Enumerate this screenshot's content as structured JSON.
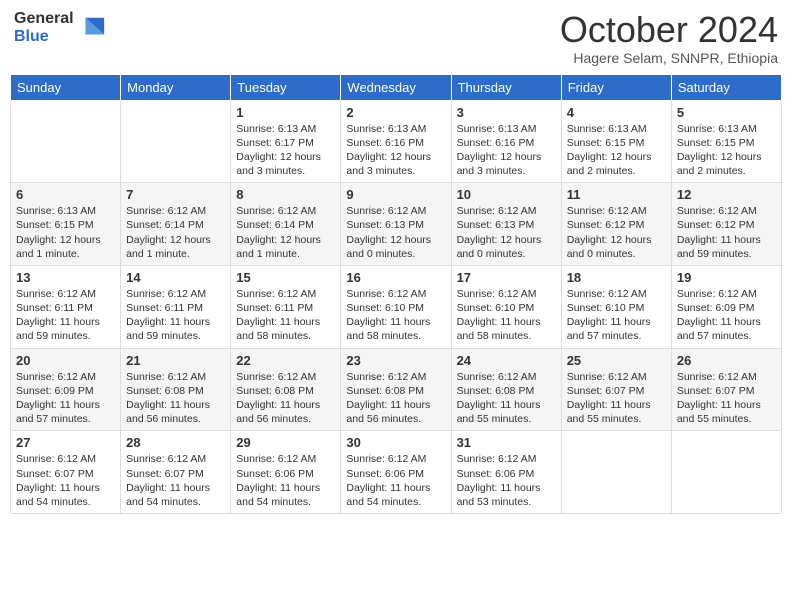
{
  "logo": {
    "general": "General",
    "blue": "Blue"
  },
  "title": "October 2024",
  "subtitle": "Hagere Selam, SNNPR, Ethiopia",
  "days_of_week": [
    "Sunday",
    "Monday",
    "Tuesday",
    "Wednesday",
    "Thursday",
    "Friday",
    "Saturday"
  ],
  "weeks": [
    [
      {
        "day": "",
        "info": ""
      },
      {
        "day": "",
        "info": ""
      },
      {
        "day": "1",
        "info": "Sunrise: 6:13 AM\nSunset: 6:17 PM\nDaylight: 12 hours and 3 minutes."
      },
      {
        "day": "2",
        "info": "Sunrise: 6:13 AM\nSunset: 6:16 PM\nDaylight: 12 hours and 3 minutes."
      },
      {
        "day": "3",
        "info": "Sunrise: 6:13 AM\nSunset: 6:16 PM\nDaylight: 12 hours and 3 minutes."
      },
      {
        "day": "4",
        "info": "Sunrise: 6:13 AM\nSunset: 6:15 PM\nDaylight: 12 hours and 2 minutes."
      },
      {
        "day": "5",
        "info": "Sunrise: 6:13 AM\nSunset: 6:15 PM\nDaylight: 12 hours and 2 minutes."
      }
    ],
    [
      {
        "day": "6",
        "info": "Sunrise: 6:13 AM\nSunset: 6:15 PM\nDaylight: 12 hours and 1 minute."
      },
      {
        "day": "7",
        "info": "Sunrise: 6:12 AM\nSunset: 6:14 PM\nDaylight: 12 hours and 1 minute."
      },
      {
        "day": "8",
        "info": "Sunrise: 6:12 AM\nSunset: 6:14 PM\nDaylight: 12 hours and 1 minute."
      },
      {
        "day": "9",
        "info": "Sunrise: 6:12 AM\nSunset: 6:13 PM\nDaylight: 12 hours and 0 minutes."
      },
      {
        "day": "10",
        "info": "Sunrise: 6:12 AM\nSunset: 6:13 PM\nDaylight: 12 hours and 0 minutes."
      },
      {
        "day": "11",
        "info": "Sunrise: 6:12 AM\nSunset: 6:12 PM\nDaylight: 12 hours and 0 minutes."
      },
      {
        "day": "12",
        "info": "Sunrise: 6:12 AM\nSunset: 6:12 PM\nDaylight: 11 hours and 59 minutes."
      }
    ],
    [
      {
        "day": "13",
        "info": "Sunrise: 6:12 AM\nSunset: 6:11 PM\nDaylight: 11 hours and 59 minutes."
      },
      {
        "day": "14",
        "info": "Sunrise: 6:12 AM\nSunset: 6:11 PM\nDaylight: 11 hours and 59 minutes."
      },
      {
        "day": "15",
        "info": "Sunrise: 6:12 AM\nSunset: 6:11 PM\nDaylight: 11 hours and 58 minutes."
      },
      {
        "day": "16",
        "info": "Sunrise: 6:12 AM\nSunset: 6:10 PM\nDaylight: 11 hours and 58 minutes."
      },
      {
        "day": "17",
        "info": "Sunrise: 6:12 AM\nSunset: 6:10 PM\nDaylight: 11 hours and 58 minutes."
      },
      {
        "day": "18",
        "info": "Sunrise: 6:12 AM\nSunset: 6:10 PM\nDaylight: 11 hours and 57 minutes."
      },
      {
        "day": "19",
        "info": "Sunrise: 6:12 AM\nSunset: 6:09 PM\nDaylight: 11 hours and 57 minutes."
      }
    ],
    [
      {
        "day": "20",
        "info": "Sunrise: 6:12 AM\nSunset: 6:09 PM\nDaylight: 11 hours and 57 minutes."
      },
      {
        "day": "21",
        "info": "Sunrise: 6:12 AM\nSunset: 6:08 PM\nDaylight: 11 hours and 56 minutes."
      },
      {
        "day": "22",
        "info": "Sunrise: 6:12 AM\nSunset: 6:08 PM\nDaylight: 11 hours and 56 minutes."
      },
      {
        "day": "23",
        "info": "Sunrise: 6:12 AM\nSunset: 6:08 PM\nDaylight: 11 hours and 56 minutes."
      },
      {
        "day": "24",
        "info": "Sunrise: 6:12 AM\nSunset: 6:08 PM\nDaylight: 11 hours and 55 minutes."
      },
      {
        "day": "25",
        "info": "Sunrise: 6:12 AM\nSunset: 6:07 PM\nDaylight: 11 hours and 55 minutes."
      },
      {
        "day": "26",
        "info": "Sunrise: 6:12 AM\nSunset: 6:07 PM\nDaylight: 11 hours and 55 minutes."
      }
    ],
    [
      {
        "day": "27",
        "info": "Sunrise: 6:12 AM\nSunset: 6:07 PM\nDaylight: 11 hours and 54 minutes."
      },
      {
        "day": "28",
        "info": "Sunrise: 6:12 AM\nSunset: 6:07 PM\nDaylight: 11 hours and 54 minutes."
      },
      {
        "day": "29",
        "info": "Sunrise: 6:12 AM\nSunset: 6:06 PM\nDaylight: 11 hours and 54 minutes."
      },
      {
        "day": "30",
        "info": "Sunrise: 6:12 AM\nSunset: 6:06 PM\nDaylight: 11 hours and 54 minutes."
      },
      {
        "day": "31",
        "info": "Sunrise: 6:12 AM\nSunset: 6:06 PM\nDaylight: 11 hours and 53 minutes."
      },
      {
        "day": "",
        "info": ""
      },
      {
        "day": "",
        "info": ""
      }
    ]
  ]
}
